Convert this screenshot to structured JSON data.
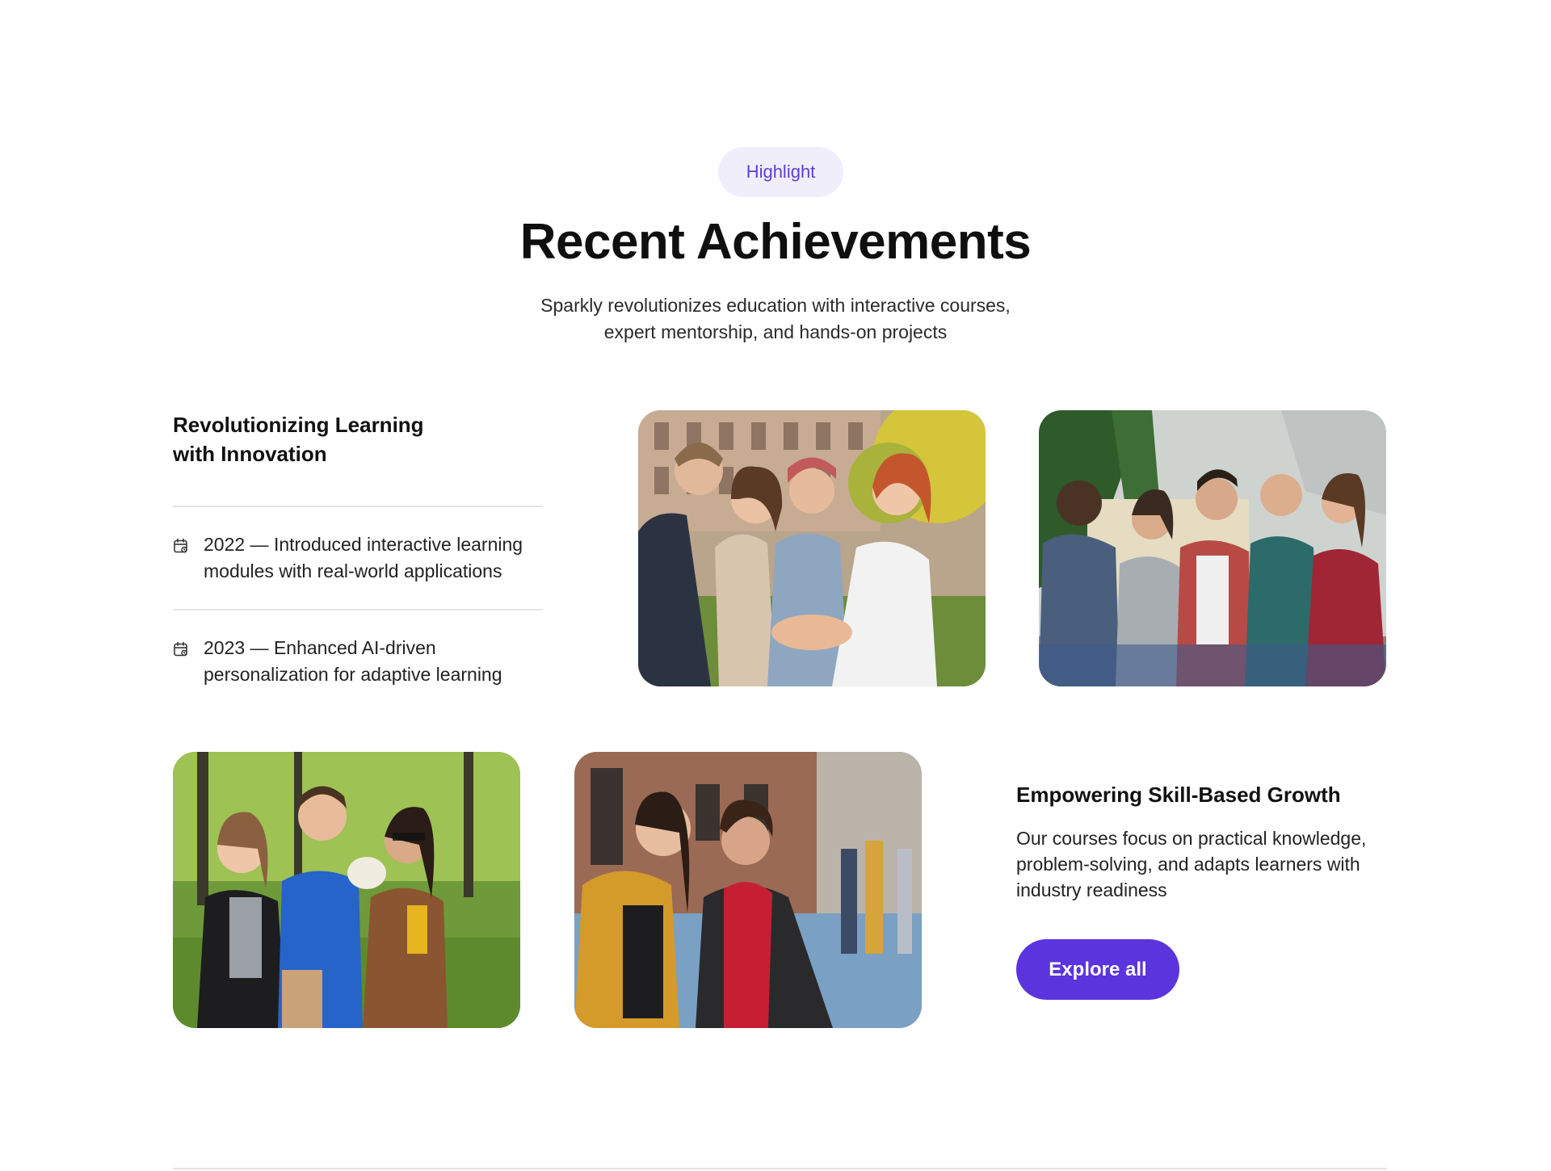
{
  "header": {
    "badge": "Highlight",
    "title": "Recent Achievements",
    "subtitle_line1": "Sparkly revolutionizes education with interactive courses,",
    "subtitle_line2": "expert mentorship, and hands-on projects"
  },
  "innovation": {
    "title_line1": "Revolutionizing Learning",
    "title_line2": "with Innovation",
    "milestones": [
      {
        "icon": "calendar-icon",
        "line1": "2022 — Introduced interactive learning",
        "line2": "modules with real-world applications"
      },
      {
        "icon": "calendar-icon",
        "line1": "2023 — Enhanced AI-driven",
        "line2": "personalization for adaptive learning"
      }
    ]
  },
  "growth": {
    "title": "Empowering Skill-Based Growth",
    "description": "Our courses focus on practical knowledge, problem-solving, and adapts learners with industry readiness",
    "cta_label": "Explore all"
  },
  "colors": {
    "accent": "#5b34de",
    "badge_bg": "#f1eefc",
    "badge_text": "#5b3fd6",
    "divider": "#e6e6e6"
  }
}
